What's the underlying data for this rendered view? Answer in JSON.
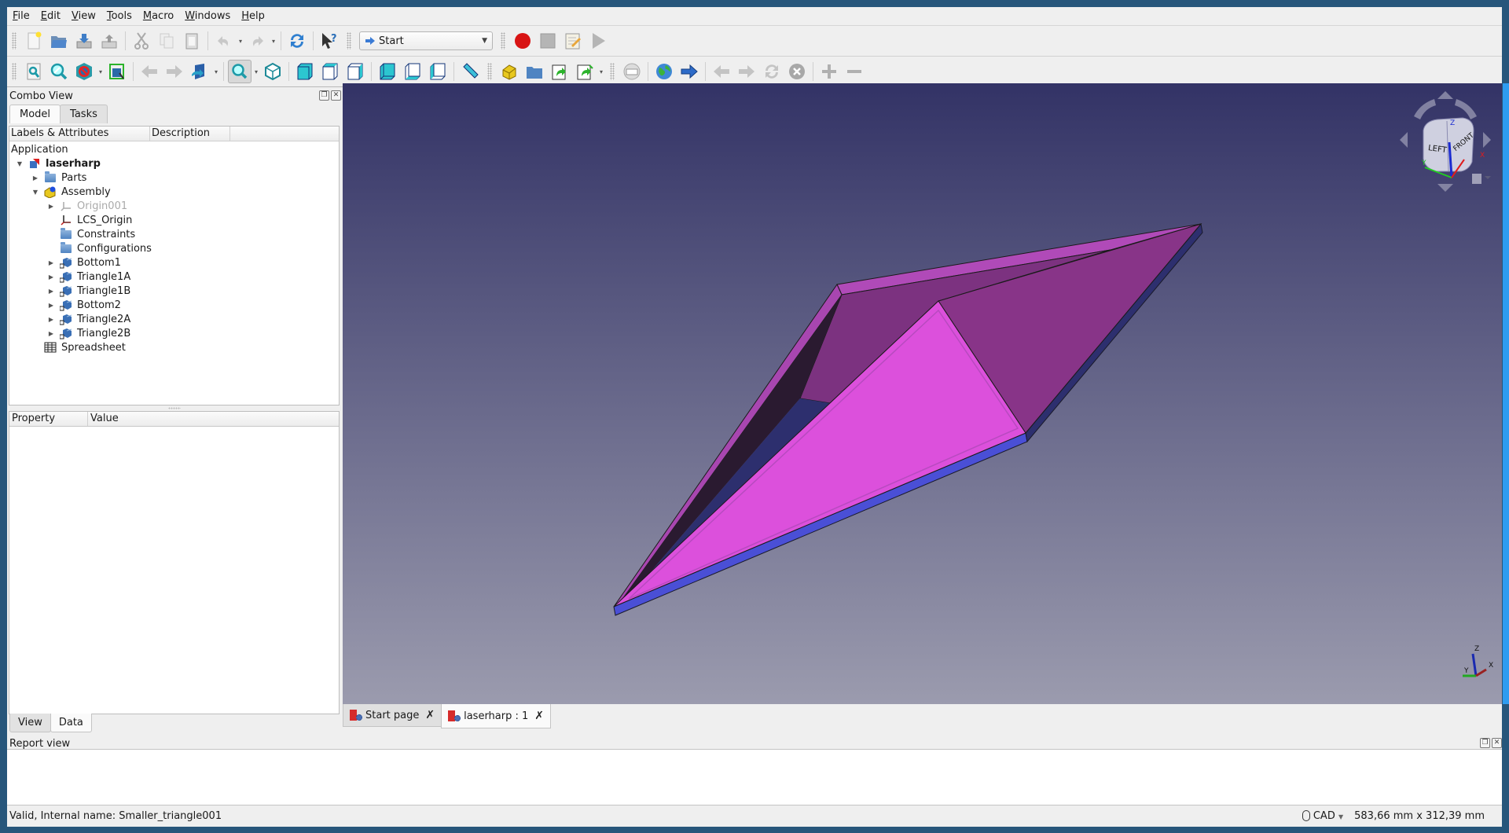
{
  "menu": [
    {
      "label": "File",
      "accel": "F"
    },
    {
      "label": "Edit",
      "accel": "E"
    },
    {
      "label": "View",
      "accel": "V"
    },
    {
      "label": "Tools",
      "accel": "T"
    },
    {
      "label": "Macro",
      "accel": "M"
    },
    {
      "label": "Windows",
      "accel": "W"
    },
    {
      "label": "Help",
      "accel": "H"
    }
  ],
  "toolbar1": {
    "workbench": "Start",
    "icons": [
      "new-document-icon",
      "open-folder-icon",
      "save-icon",
      "save-as-icon",
      "cut-icon",
      "copy-icon",
      "paste-icon",
      "undo-icon",
      "redo-icon",
      "refresh-icon",
      "whats-this-icon",
      "macro-record-icon",
      "macro-stop-icon",
      "macro-edit-icon",
      "macro-run-icon"
    ]
  },
  "toolbar2": {
    "icons": [
      "fit-all-icon",
      "fit-selection-icon",
      "draw-style-icon",
      "bounding-box-icon",
      "back-icon",
      "forward-icon",
      "sync-view-icon",
      "zoom-icon",
      "isometric-icon",
      "front-view-icon",
      "top-view-icon",
      "right-view-icon",
      "rear-view-icon",
      "bottom-view-icon",
      "left-view-icon",
      "measure-icon",
      "part-icon",
      "group-icon",
      "link-icon",
      "link-actions-icon",
      "web-page-icon",
      "web-globe-icon",
      "web-go-icon",
      "web-back-icon",
      "web-next-icon",
      "web-refresh-icon",
      "web-stop-icon",
      "zoom-in-icon",
      "zoom-out-icon"
    ]
  },
  "combo": {
    "title": "Combo View",
    "tabs": [
      "Model",
      "Tasks"
    ],
    "active_tab": "Model",
    "tree_columns": [
      "Labels & Attributes",
      "Description"
    ],
    "tree": [
      {
        "label": "Application",
        "level": 0,
        "icon": "none",
        "twisty": "",
        "bold": false,
        "dim": false
      },
      {
        "label": "laserharp",
        "level": 1,
        "icon": "document-icon",
        "twisty": "open",
        "bold": true,
        "dim": false
      },
      {
        "label": "Parts",
        "level": 2,
        "icon": "folder-icon",
        "twisty": "closed",
        "bold": false,
        "dim": false
      },
      {
        "label": "Assembly",
        "level": 2,
        "icon": "assembly-icon",
        "twisty": "open",
        "bold": false,
        "dim": false
      },
      {
        "label": "Origin001",
        "level": 3,
        "icon": "origin-icon",
        "twisty": "closed",
        "bold": false,
        "dim": true
      },
      {
        "label": "LCS_Origin",
        "level": 3,
        "icon": "lcs-icon",
        "twisty": "",
        "bold": false,
        "dim": false
      },
      {
        "label": "Constraints",
        "level": 3,
        "icon": "folder-icon",
        "twisty": "",
        "bold": false,
        "dim": false
      },
      {
        "label": "Configurations",
        "level": 3,
        "icon": "folder-icon",
        "twisty": "",
        "bold": false,
        "dim": false
      },
      {
        "label": "Bottom1",
        "level": 3,
        "icon": "link-part-icon",
        "twisty": "closed",
        "bold": false,
        "dim": false
      },
      {
        "label": "Triangle1A",
        "level": 3,
        "icon": "link-part-icon",
        "twisty": "closed",
        "bold": false,
        "dim": false
      },
      {
        "label": "Triangle1B",
        "level": 3,
        "icon": "link-part-icon",
        "twisty": "closed",
        "bold": false,
        "dim": false
      },
      {
        "label": "Bottom2",
        "level": 3,
        "icon": "link-part-icon",
        "twisty": "closed",
        "bold": false,
        "dim": false
      },
      {
        "label": "Triangle2A",
        "level": 3,
        "icon": "link-part-icon",
        "twisty": "closed",
        "bold": false,
        "dim": false
      },
      {
        "label": "Triangle2B",
        "level": 3,
        "icon": "link-part-icon",
        "twisty": "closed",
        "bold": false,
        "dim": false
      },
      {
        "label": "Spreadsheet",
        "level": 2,
        "icon": "spreadsheet-icon",
        "twisty": "",
        "bold": false,
        "dim": false
      }
    ],
    "property_columns": [
      "Property",
      "Value"
    ],
    "bottom_tabs": [
      "View",
      "Data"
    ],
    "active_bottom_tab": "Data"
  },
  "view3d": {
    "colors": {
      "face_light": "#dc50dc",
      "face_mid": "#a846b0",
      "face_dark": "#873489",
      "inner_shadow": "#2a1a30",
      "slab_blue": "#4a4fd6",
      "slab_dark": "#2d2f6e"
    },
    "navcube": {
      "faces": [
        "LEFT",
        "FRONT"
      ],
      "axes": [
        "X",
        "Y",
        "Z"
      ]
    },
    "axis_labels": [
      "X",
      "Y",
      "Z"
    ]
  },
  "doc_tabs": [
    {
      "label": "Start page",
      "active": false
    },
    {
      "label": "laserharp : 1",
      "active": true
    }
  ],
  "report": {
    "title": "Report view"
  },
  "status": {
    "message": "Valid, Internal name: Smaller_triangle001",
    "nav_style": "CAD",
    "dimensions": "583,66 mm x 312,39 mm"
  }
}
